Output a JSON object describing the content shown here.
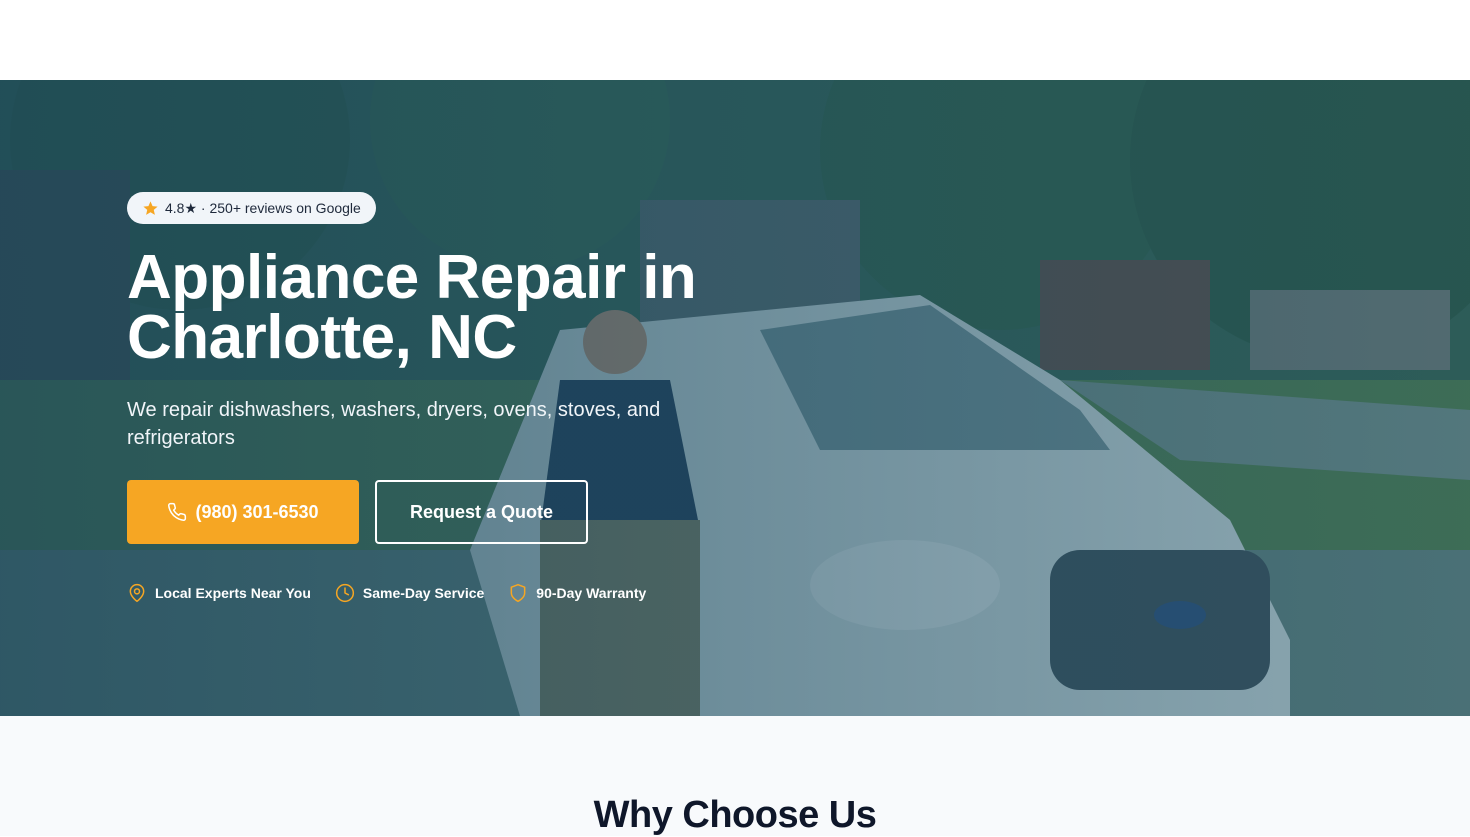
{
  "header": {},
  "hero": {
    "rating": "4.8★ · 250+ reviews on Google",
    "title": "Appliance Repair in Charlotte, NC",
    "subtitle": "We repair dishwashers, washers, dryers, ovens, stoves, and refrigerators",
    "call_label": "(980) 301-6530",
    "quote_label": "Request a Quote",
    "features": [
      {
        "icon": "map-pin-icon",
        "label": "Local Experts Near You"
      },
      {
        "icon": "clock-icon",
        "label": "Same-Day Service"
      },
      {
        "icon": "shield-icon",
        "label": "90-Day Warranty"
      }
    ]
  },
  "why": {
    "title": "Why Choose Us"
  },
  "colors": {
    "accent": "#f6a623",
    "overlay": "#1e4e64",
    "section_bg": "#f8fafc"
  }
}
